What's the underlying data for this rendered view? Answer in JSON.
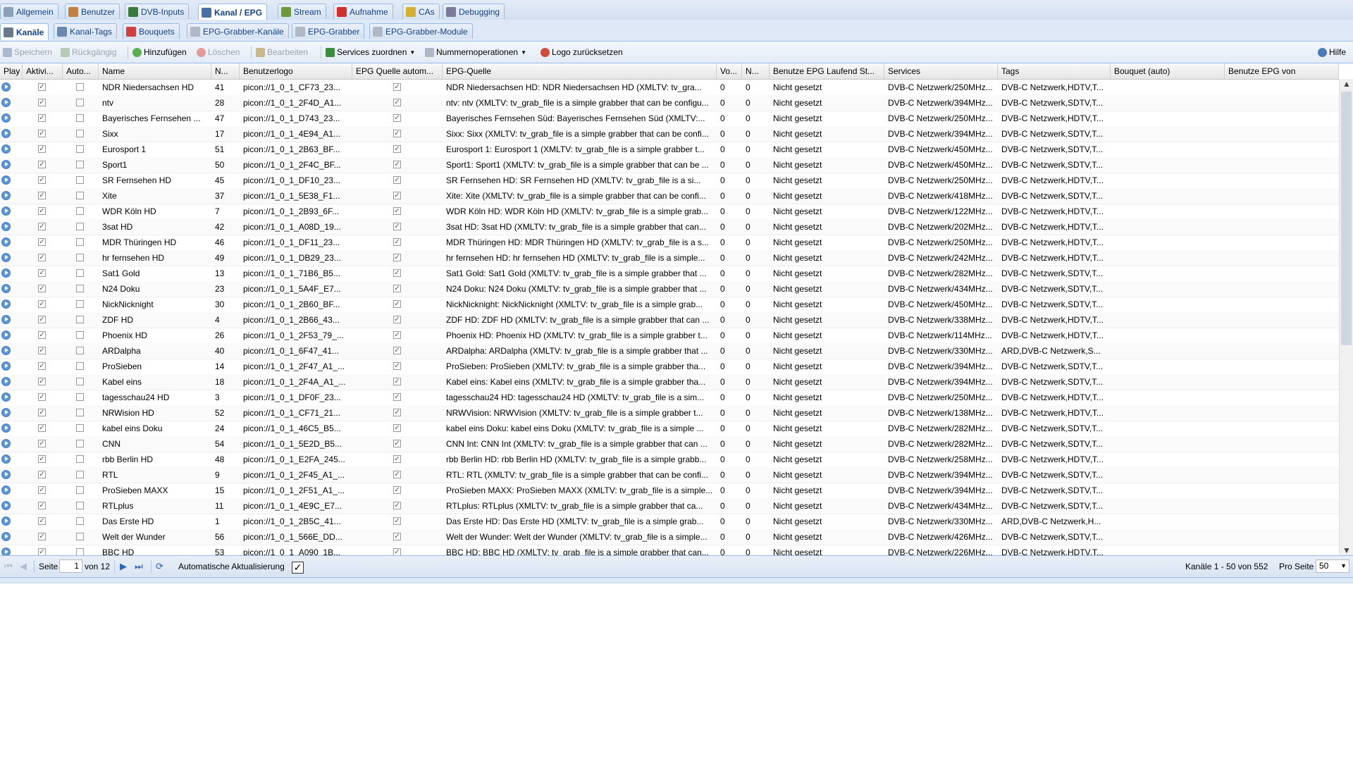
{
  "tabs_top": [
    {
      "label": "Allgemein",
      "icon": "wrench-icon",
      "color": "#8aa0b8"
    },
    {
      "label": "Benutzer",
      "icon": "users-icon",
      "color": "#c08040"
    },
    {
      "label": "DVB-Inputs",
      "icon": "dvb-card-icon",
      "color": "#3a7a3a"
    },
    {
      "label": "Kanal / EPG",
      "icon": "tv-icon",
      "color": "#4a6fa5",
      "active": true
    },
    {
      "label": "Stream",
      "icon": "stream-icon",
      "color": "#6c9a3a"
    },
    {
      "label": "Aufnahme",
      "icon": "record-icon",
      "color": "#d03030"
    },
    {
      "label": "CAs",
      "icon": "key-icon",
      "color": "#d8b030"
    },
    {
      "label": "Debugging",
      "icon": "debug-icon",
      "color": "#7a7a9a"
    }
  ],
  "tabs_sub": [
    {
      "label": "Kanäle",
      "icon": "channels-icon",
      "color": "#6a7a8a",
      "active": true
    },
    {
      "label": "Kanal-Tags",
      "icon": "tag-icon",
      "color": "#6a88b0"
    },
    {
      "label": "Bouquets",
      "icon": "bouquet-icon",
      "color": "#d04040"
    },
    {
      "label": "EPG-Grabber-Kanäle",
      "icon": "epg-grabber-channels-icon",
      "color": "#b0b8c8"
    },
    {
      "label": "EPG-Grabber",
      "icon": "epg-grabber-icon",
      "color": "#b0b8c8"
    },
    {
      "label": "EPG-Grabber-Module",
      "icon": "epg-grabber-modules-icon",
      "color": "#b0b8c8"
    }
  ],
  "toolbar": {
    "save": "Speichern",
    "undo": "Rückgängig",
    "add": "Hinzufügen",
    "delete": "Löschen",
    "edit": "Bearbeiten",
    "assign_services": "Services zuordnen",
    "number_ops": "Nummernoperationen",
    "reset_logo": "Logo zurücksetzen",
    "help": "Hilfe"
  },
  "columns": [
    "Play",
    "Aktivi...",
    "Auto...",
    "Name",
    "N...",
    "Benutzerlogo",
    "EPG Quelle autom...",
    "EPG-Quelle",
    "Vo...",
    "N...",
    "Benutze EPG Laufend St...",
    "Services",
    "Tags",
    "Bouquet (auto)",
    "Benutze EPG von"
  ],
  "rows": [
    {
      "name": "NDR Niedersachsen HD",
      "num": "41",
      "logo": "picon://1_0_1_CF73_23...",
      "epg": "NDR Niedersachsen HD: NDR Niedersachsen HD (XMLTV: tv_gra...",
      "vo": "0",
      "n": "0",
      "running": "Nicht gesetzt",
      "services": "DVB-C Netzwerk/250MHz...",
      "tags": "DVB-C Netzwerk,HDTV,T..."
    },
    {
      "name": "ntv",
      "num": "28",
      "logo": "picon://1_0_1_2F4D_A1...",
      "epg": "ntv: ntv (XMLTV: tv_grab_file is a simple grabber that can be configu...",
      "vo": "0",
      "n": "0",
      "running": "Nicht gesetzt",
      "services": "DVB-C Netzwerk/394MHz...",
      "tags": "DVB-C Netzwerk,SDTV,T..."
    },
    {
      "name": "Bayerisches Fernsehen ...",
      "num": "47",
      "logo": "picon://1_0_1_D743_23...",
      "epg": "Bayerisches Fernsehen Süd: Bayerisches Fernsehen Süd (XMLTV:...",
      "vo": "0",
      "n": "0",
      "running": "Nicht gesetzt",
      "services": "DVB-C Netzwerk/250MHz...",
      "tags": "DVB-C Netzwerk,HDTV,T..."
    },
    {
      "name": "Sixx",
      "num": "17",
      "logo": "picon://1_0_1_4E94_A1...",
      "epg": "Sixx: Sixx (XMLTV: tv_grab_file is a simple grabber that can be confi...",
      "vo": "0",
      "n": "0",
      "running": "Nicht gesetzt",
      "services": "DVB-C Netzwerk/394MHz...",
      "tags": "DVB-C Netzwerk,SDTV,T..."
    },
    {
      "name": "Eurosport 1",
      "num": "51",
      "logo": "picon://1_0_1_2B63_BF...",
      "epg": "Eurosport 1: Eurosport 1 (XMLTV: tv_grab_file is a simple grabber t...",
      "vo": "0",
      "n": "0",
      "running": "Nicht gesetzt",
      "services": "DVB-C Netzwerk/450MHz...",
      "tags": "DVB-C Netzwerk,SDTV,T..."
    },
    {
      "name": "Sport1",
      "num": "50",
      "logo": "picon://1_0_1_2F4C_BF...",
      "epg": "Sport1: Sport1 (XMLTV: tv_grab_file is a simple grabber that can be ...",
      "vo": "0",
      "n": "0",
      "running": "Nicht gesetzt",
      "services": "DVB-C Netzwerk/450MHz...",
      "tags": "DVB-C Netzwerk,SDTV,T..."
    },
    {
      "name": "SR Fernsehen HD",
      "num": "45",
      "logo": "picon://1_0_1_DF10_23...",
      "epg": "SR Fernsehen HD: SR Fernsehen HD (XMLTV: tv_grab_file is a si...",
      "vo": "0",
      "n": "0",
      "running": "Nicht gesetzt",
      "services": "DVB-C Netzwerk/250MHz...",
      "tags": "DVB-C Netzwerk,HDTV,T..."
    },
    {
      "name": "Xite",
      "num": "37",
      "logo": "picon://1_0_1_5E38_F1...",
      "epg": "Xite: Xite (XMLTV: tv_grab_file is a simple grabber that can be confi...",
      "vo": "0",
      "n": "0",
      "running": "Nicht gesetzt",
      "services": "DVB-C Netzwerk/418MHz...",
      "tags": "DVB-C Netzwerk,SDTV,T..."
    },
    {
      "name": "WDR Köln HD",
      "num": "7",
      "logo": "picon://1_0_1_2B93_6F...",
      "epg": "WDR Köln HD: WDR Köln HD (XMLTV: tv_grab_file is a simple grab...",
      "vo": "0",
      "n": "0",
      "running": "Nicht gesetzt",
      "services": "DVB-C Netzwerk/122MHz...",
      "tags": "DVB-C Netzwerk,HDTV,T..."
    },
    {
      "name": "3sat HD",
      "num": "42",
      "logo": "picon://1_0_1_A08D_19...",
      "epg": "3sat HD: 3sat HD (XMLTV: tv_grab_file is a simple grabber that can...",
      "vo": "0",
      "n": "0",
      "running": "Nicht gesetzt",
      "services": "DVB-C Netzwerk/202MHz...",
      "tags": "DVB-C Netzwerk,HDTV,T..."
    },
    {
      "name": "MDR Thüringen HD",
      "num": "46",
      "logo": "picon://1_0_1_DF11_23...",
      "epg": "MDR Thüringen HD: MDR Thüringen HD (XMLTV: tv_grab_file is a s...",
      "vo": "0",
      "n": "0",
      "running": "Nicht gesetzt",
      "services": "DVB-C Netzwerk/250MHz...",
      "tags": "DVB-C Netzwerk,HDTV,T..."
    },
    {
      "name": "hr fernsehen HD",
      "num": "49",
      "logo": "picon://1_0_1_DB29_23...",
      "epg": "hr fernsehen HD: hr fernsehen HD (XMLTV: tv_grab_file is a simple...",
      "vo": "0",
      "n": "0",
      "running": "Nicht gesetzt",
      "services": "DVB-C Netzwerk/242MHz...",
      "tags": "DVB-C Netzwerk,HDTV,T..."
    },
    {
      "name": "Sat1 Gold",
      "num": "13",
      "logo": "picon://1_0_1_71B6_B5...",
      "epg": "Sat1 Gold: Sat1 Gold (XMLTV: tv_grab_file is a simple grabber that ...",
      "vo": "0",
      "n": "0",
      "running": "Nicht gesetzt",
      "services": "DVB-C Netzwerk/282MHz...",
      "tags": "DVB-C Netzwerk,SDTV,T..."
    },
    {
      "name": "N24 Doku",
      "num": "23",
      "logo": "picon://1_0_1_5A4F_E7...",
      "epg": "N24 Doku: N24 Doku (XMLTV: tv_grab_file is a simple grabber that ...",
      "vo": "0",
      "n": "0",
      "running": "Nicht gesetzt",
      "services": "DVB-C Netzwerk/434MHz...",
      "tags": "DVB-C Netzwerk,SDTV,T..."
    },
    {
      "name": "NickNicknight",
      "num": "30",
      "logo": "picon://1_0_1_2B60_BF...",
      "epg": "NickNicknight: NickNicknight (XMLTV: tv_grab_file is a simple grab...",
      "vo": "0",
      "n": "0",
      "running": "Nicht gesetzt",
      "services": "DVB-C Netzwerk/450MHz...",
      "tags": "DVB-C Netzwerk,SDTV,T..."
    },
    {
      "name": "ZDF HD",
      "num": "4",
      "logo": "picon://1_0_1_2B66_43...",
      "epg": "ZDF HD: ZDF HD (XMLTV: tv_grab_file is a simple grabber that can ...",
      "vo": "0",
      "n": "0",
      "running": "Nicht gesetzt",
      "services": "DVB-C Netzwerk/338MHz...",
      "tags": "DVB-C Netzwerk,HDTV,T..."
    },
    {
      "name": "Phoenix HD",
      "num": "26",
      "logo": "picon://1_0_1_2F53_79_...",
      "epg": "Phoenix HD: Phoenix HD (XMLTV: tv_grab_file is a simple grabber t...",
      "vo": "0",
      "n": "0",
      "running": "Nicht gesetzt",
      "services": "DVB-C Netzwerk/114MHz...",
      "tags": "DVB-C Netzwerk,HDTV,T..."
    },
    {
      "name": "ARDalpha",
      "num": "40",
      "logo": "picon://1_0_1_6F47_41...",
      "epg": "ARDalpha: ARDalpha (XMLTV: tv_grab_file is a simple grabber that ...",
      "vo": "0",
      "n": "0",
      "running": "Nicht gesetzt",
      "services": "DVB-C Netzwerk/330MHz...",
      "tags": "ARD,DVB-C Netzwerk,S..."
    },
    {
      "name": "ProSieben",
      "num": "14",
      "logo": "picon://1_0_1_2F47_A1_...",
      "epg": "ProSieben: ProSieben (XMLTV: tv_grab_file is a simple grabber tha...",
      "vo": "0",
      "n": "0",
      "running": "Nicht gesetzt",
      "services": "DVB-C Netzwerk/394MHz...",
      "tags": "DVB-C Netzwerk,SDTV,T..."
    },
    {
      "name": "Kabel eins",
      "num": "18",
      "logo": "picon://1_0_1_2F4A_A1_...",
      "epg": "Kabel eins: Kabel eins (XMLTV: tv_grab_file is a simple grabber tha...",
      "vo": "0",
      "n": "0",
      "running": "Nicht gesetzt",
      "services": "DVB-C Netzwerk/394MHz...",
      "tags": "DVB-C Netzwerk,SDTV,T..."
    },
    {
      "name": "tagesschau24 HD",
      "num": "3",
      "logo": "picon://1_0_1_DF0F_23...",
      "epg": "tagesschau24 HD: tagesschau24 HD (XMLTV: tv_grab_file is a sim...",
      "vo": "0",
      "n": "0",
      "running": "Nicht gesetzt",
      "services": "DVB-C Netzwerk/250MHz...",
      "tags": "DVB-C Netzwerk,HDTV,T..."
    },
    {
      "name": "NRWision HD",
      "num": "52",
      "logo": "picon://1_0_1_CF71_21...",
      "epg": "NRWVision: NRWVision (XMLTV: tv_grab_file is a simple grabber t...",
      "vo": "0",
      "n": "0",
      "running": "Nicht gesetzt",
      "services": "DVB-C Netzwerk/138MHz...",
      "tags": "DVB-C Netzwerk,HDTV,T..."
    },
    {
      "name": "kabel eins Doku",
      "num": "24",
      "logo": "picon://1_0_1_46C5_B5...",
      "epg": "kabel eins Doku: kabel eins Doku (XMLTV: tv_grab_file is a simple ...",
      "vo": "0",
      "n": "0",
      "running": "Nicht gesetzt",
      "services": "DVB-C Netzwerk/282MHz...",
      "tags": "DVB-C Netzwerk,SDTV,T..."
    },
    {
      "name": "CNN",
      "num": "54",
      "logo": "picon://1_0_1_5E2D_B5...",
      "epg": "CNN Int: CNN Int (XMLTV: tv_grab_file is a simple grabber that can ...",
      "vo": "0",
      "n": "0",
      "running": "Nicht gesetzt",
      "services": "DVB-C Netzwerk/282MHz...",
      "tags": "DVB-C Netzwerk,SDTV,T..."
    },
    {
      "name": "rbb Berlin HD",
      "num": "48",
      "logo": "picon://1_0_1_E2FA_245...",
      "epg": "rbb Berlin HD: rbb Berlin HD (XMLTV: tv_grab_file is a simple grabb...",
      "vo": "0",
      "n": "0",
      "running": "Nicht gesetzt",
      "services": "DVB-C Netzwerk/258MHz...",
      "tags": "DVB-C Netzwerk,HDTV,T..."
    },
    {
      "name": "RTL",
      "num": "9",
      "logo": "picon://1_0_1_2F45_A1_...",
      "epg": "RTL: RTL (XMLTV: tv_grab_file is a simple grabber that can be confi...",
      "vo": "0",
      "n": "0",
      "running": "Nicht gesetzt",
      "services": "DVB-C Netzwerk/394MHz...",
      "tags": "DVB-C Netzwerk,SDTV,T..."
    },
    {
      "name": "ProSieben MAXX",
      "num": "15",
      "logo": "picon://1_0_1_2F51_A1_...",
      "epg": "ProSieben MAXX: ProSieben MAXX (XMLTV: tv_grab_file is a simple...",
      "vo": "0",
      "n": "0",
      "running": "Nicht gesetzt",
      "services": "DVB-C Netzwerk/394MHz...",
      "tags": "DVB-C Netzwerk,SDTV,T..."
    },
    {
      "name": "RTLplus",
      "num": "11",
      "logo": "picon://1_0_1_4E9C_E7...",
      "epg": "RTLplus: RTLplus (XMLTV: tv_grab_file is a simple grabber that ca...",
      "vo": "0",
      "n": "0",
      "running": "Nicht gesetzt",
      "services": "DVB-C Netzwerk/434MHz...",
      "tags": "DVB-C Netzwerk,SDTV,T..."
    },
    {
      "name": "Das Erste HD",
      "num": "1",
      "logo": "picon://1_0_1_2B5C_41...",
      "epg": "Das Erste HD: Das Erste HD (XMLTV: tv_grab_file is a simple grab...",
      "vo": "0",
      "n": "0",
      "running": "Nicht gesetzt",
      "services": "DVB-C Netzwerk/330MHz...",
      "tags": "ARD,DVB-C Netzwerk,H..."
    },
    {
      "name": "Welt der Wunder",
      "num": "56",
      "logo": "picon://1_0_1_566E_DD...",
      "epg": "Welt der Wunder: Welt der Wunder (XMLTV: tv_grab_file is a simple...",
      "vo": "0",
      "n": "0",
      "running": "Nicht gesetzt",
      "services": "DVB-C Netzwerk/426MHz...",
      "tags": "DVB-C Netzwerk,SDTV,T..."
    },
    {
      "name": "BBC HD",
      "num": "53",
      "logo": "picon://1_0_1_A090_1B...",
      "epg": "BBC HD: BBC HD (XMLTV: tv_grab_file is a simple grabber that can...",
      "vo": "0",
      "n": "0",
      "running": "Nicht gesetzt",
      "services": "DVB-C Netzwerk/226MHz...",
      "tags": "DVB-C Netzwerk,HDTV,T..."
    }
  ],
  "paging": {
    "page_label": "Seite",
    "page_value": "1",
    "of_label": "von 12",
    "auto_refresh_label": "Automatische Aktualisierung",
    "summary": "Kanäle 1 - 50 von 552",
    "per_page_label": "Pro Seite",
    "per_page_value": "50"
  }
}
